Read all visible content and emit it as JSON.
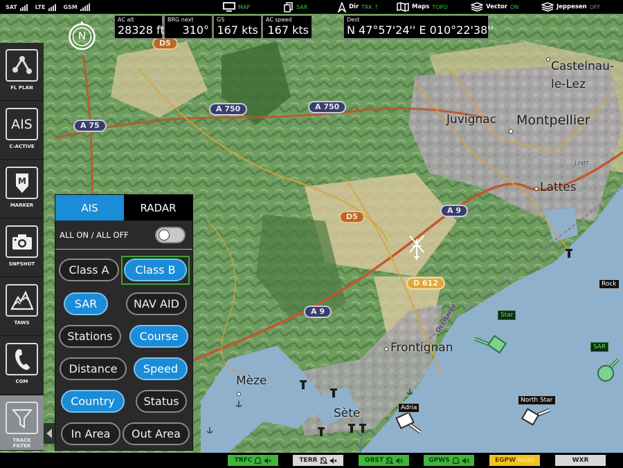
{
  "top_bar": {
    "signals": [
      {
        "label": "SAT",
        "bars": 4
      },
      {
        "label": "LTE",
        "bars": 4
      },
      {
        "label": "GSM",
        "bars": 5
      }
    ],
    "items": [
      {
        "icon": "monitor-icon",
        "key": "",
        "value": "MAP",
        "value_state": "on"
      },
      {
        "icon": "copy-icon",
        "key": "",
        "value": "SAR",
        "value_state": "on"
      },
      {
        "icon": "direction-arrow-icon",
        "key": "Dir",
        "value": "TRK ↑",
        "value_state": "on"
      },
      {
        "icon": "map-icon",
        "key": "Maps",
        "value": "TOPO",
        "value_state": "on"
      },
      {
        "icon": "layers-icon",
        "key": "Vector",
        "value": "ON",
        "value_state": "on"
      },
      {
        "icon": "layers-icon",
        "key": "Jeppesen",
        "value": "OFF",
        "value_state": "off"
      }
    ]
  },
  "info_boxes": [
    {
      "label": "AC alt",
      "value": "28328 ft"
    },
    {
      "label": "BRG next",
      "value": "310°"
    },
    {
      "label": "GS",
      "value": "167 kts"
    },
    {
      "label": "AC speed",
      "value": "167 kts"
    },
    {
      "label": "Dest",
      "value": "N 47°57'24'' E 010°22'38''"
    }
  ],
  "compass": {
    "label": "N"
  },
  "sidebar": {
    "items": [
      {
        "label": "FL PLAN",
        "icon": "flight-plan-icon",
        "active": false
      },
      {
        "label": "AIS",
        "sublabel": "C-ACTIVE",
        "icon": "ais-icon",
        "active": false
      },
      {
        "label": "MARKER",
        "icon": "marker-icon",
        "icon_text": "M",
        "active": false
      },
      {
        "label": "SNPSHOT",
        "icon": "camera-icon",
        "active": false
      },
      {
        "label": "TAWS",
        "icon": "mountain-icon",
        "active": false
      },
      {
        "label": "COM",
        "icon": "phone-icon",
        "active": false
      },
      {
        "label": "TRACK FILTER",
        "icon": "filter-icon",
        "active": true
      }
    ]
  },
  "filter_panel": {
    "tabs": [
      {
        "label": "AIS",
        "selected": true
      },
      {
        "label": "RADAR",
        "selected": false
      }
    ],
    "all_toggle": {
      "label": "ALL ON / ALL OFF",
      "on": false
    },
    "chips": [
      {
        "label": "Class A",
        "on": false
      },
      {
        "label": "Class B",
        "on": true,
        "focused": true
      },
      {
        "label": "SAR",
        "on": true
      },
      {
        "label": "NAV AID",
        "on": false
      },
      {
        "label": "Stations",
        "on": false
      },
      {
        "label": "Course",
        "on": true
      },
      {
        "label": "Distance",
        "on": false
      },
      {
        "label": "Speed",
        "on": true
      },
      {
        "label": "Country",
        "on": true
      },
      {
        "label": "Status",
        "on": false
      },
      {
        "label": "In Area",
        "on": false
      },
      {
        "label": "Out Area",
        "on": false
      }
    ]
  },
  "map": {
    "places": [
      {
        "name": "Castelnau-",
        "size": "large"
      },
      {
        "name": "le-Lez",
        "size": "large"
      },
      {
        "name": "Juvignac",
        "size": "large"
      },
      {
        "name": "Montpellier",
        "size": "xlarge"
      },
      {
        "name": "Lattes",
        "size": "large"
      },
      {
        "name": "Frontignan",
        "size": "large"
      },
      {
        "name": "Mèze",
        "size": "large"
      },
      {
        "name": "Sète",
        "size": "large"
      },
      {
        "name": "Occitanie",
        "size": "small"
      },
      {
        "name": "LFMT",
        "size": "small"
      }
    ],
    "roads": [
      "A 750",
      "A 750",
      "A 75",
      "D5",
      "D5",
      "A 9",
      "A 9",
      "D 612"
    ],
    "vessels": [
      {
        "name": "Star",
        "type": "sar-green"
      },
      {
        "name": "SAR",
        "type": "sar-green"
      },
      {
        "name": "Adria",
        "type": "white"
      },
      {
        "name": "North Star",
        "type": "white"
      },
      {
        "name": "Rock",
        "type": "white"
      }
    ]
  },
  "bottom_bar": {
    "alerts": [
      {
        "label": "TRFC",
        "state": "green",
        "icons": [
          "bell-icon",
          "speaker-mute-icon"
        ]
      },
      {
        "label": "TERR",
        "state": "grey",
        "icons": [
          "bell-off-icon",
          "speaker-mute-icon"
        ]
      },
      {
        "label": "OBST",
        "state": "green",
        "icons": [
          "bell-off-icon",
          "speaker-on-icon"
        ]
      },
      {
        "label": "GPWS",
        "state": "green",
        "icons": [
          "bell-icon",
          "speaker-on-icon"
        ]
      },
      {
        "label": "EGPW",
        "sublabel": "FAILED",
        "state": "amber",
        "icons": []
      },
      {
        "label": "WXR",
        "state": "grey",
        "icons": []
      }
    ]
  }
}
